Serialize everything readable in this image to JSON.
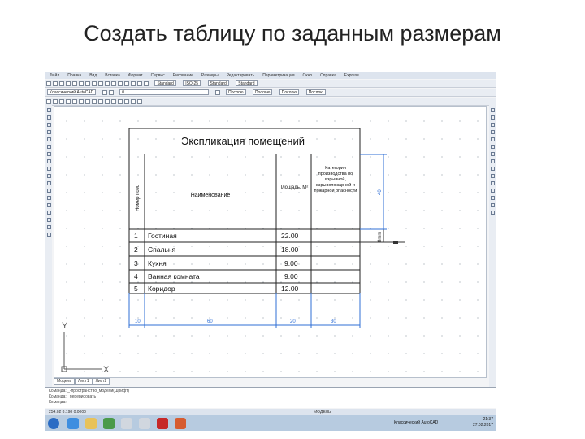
{
  "slide_title": "Создать таблицу по заданным размерам",
  "menu": [
    "Файл",
    "Правка",
    "Вид",
    "Вставка",
    "Формат",
    "Сервис",
    "Рисование",
    "Размеры",
    "Редактировать",
    "Параметризация",
    "Окно",
    "Справка",
    "Express"
  ],
  "toolbar": {
    "style_standard_1": "Standard",
    "dim_style": "ISO-25",
    "style_standard_2": "Standard",
    "style_standard_3": "Standard",
    "workspace": "Классический AutoCAD",
    "layer": "0",
    "bylayer_color": "Поcлою",
    "bylayer_linetype": "Поcлою",
    "bylayer_lineweight": "Поcлою",
    "plot_style": "Поcлою"
  },
  "drawing": {
    "table_title": "Экспликация помещений",
    "col_number": "Номер пом.",
    "col_name": "Наименование",
    "col_area": "Площадь, М²",
    "col_category": "Категория производства по взрывной, взрывопожарной и пожарной опасности",
    "rows": [
      {
        "num": "1",
        "name": "Гостиная",
        "area": "22.00"
      },
      {
        "num": "2",
        "name": "Спальня",
        "area": "18.00"
      },
      {
        "num": "3",
        "name": "Кухня",
        "area": "9.00"
      },
      {
        "num": "4",
        "name": "Ванная комната",
        "area": "9.00"
      },
      {
        "num": "5",
        "name": "Коридор",
        "area": "12.00"
      }
    ],
    "dim_col1": "10",
    "dim_col2": "60",
    "dim_col3": "20",
    "dim_col4": "30",
    "dim_header_height": "40",
    "dim_row_height": "8mm",
    "axis_y": "Y",
    "axis_x": "X"
  },
  "tabs": [
    "Модель",
    "Лист1",
    "Лист2"
  ],
  "command_lines": [
    "Команда: _-пространство_модели(Шрифт)",
    "Команда: _перерисовать",
    "Команда:"
  ],
  "status_text": "254.02 8.198 0.0000",
  "status_mode": "МОДЕЛЬ",
  "taskbar_app": "Классический AutoCAD",
  "clock_time": "21:37",
  "clock_date": "27.02.2017",
  "colors": {
    "accent_dim": "#2f6fd6",
    "table_line": "#222222",
    "taskbar": "#b7cbe0"
  }
}
